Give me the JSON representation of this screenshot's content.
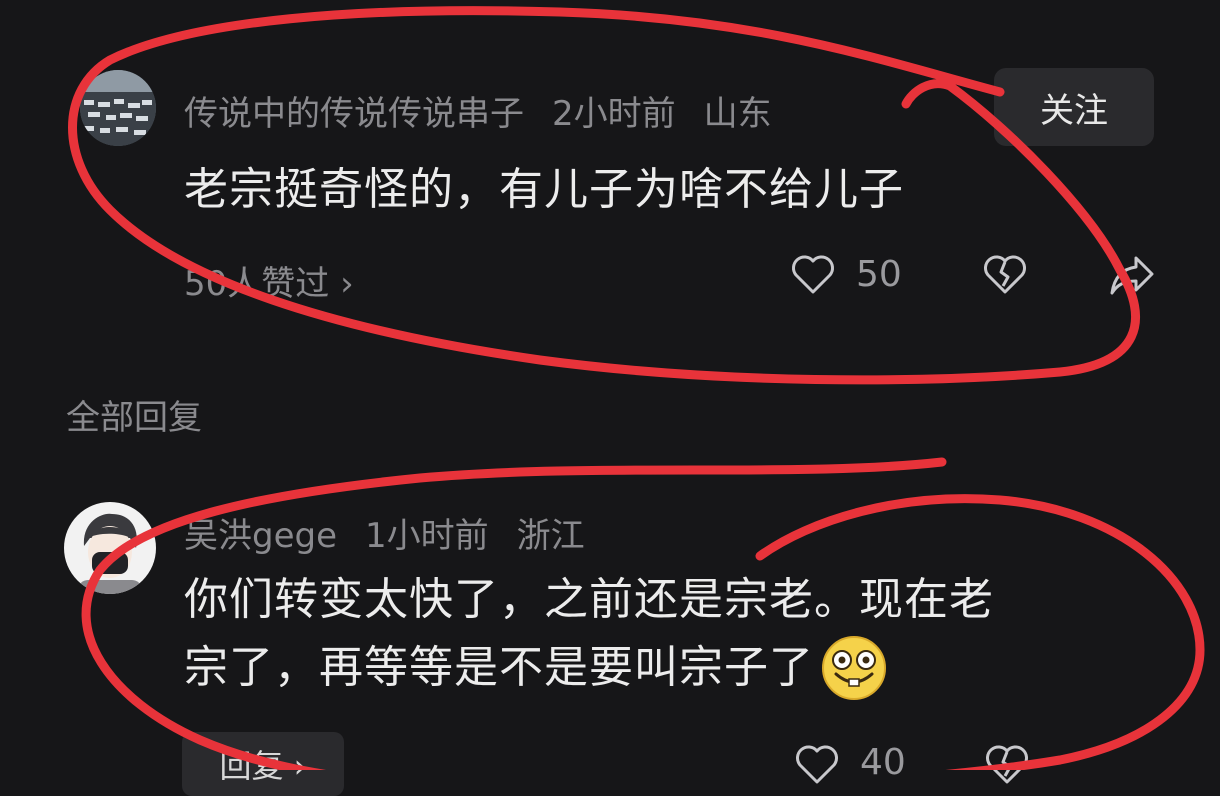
{
  "comment": {
    "author": "传说中的传说传说串子",
    "time": "2小时前",
    "location": "山东",
    "follow_label": "关注",
    "text": "老宗挺奇怪的，有儿子为啥不给儿子",
    "likes_link": "50人赞过 ›",
    "like_count": "50"
  },
  "section_title": "全部回复",
  "reply": {
    "author": "吴洪gege",
    "time": "1小时前",
    "location": "浙江",
    "text_line1": "你们转变太快了，之前还是宗老。现在老",
    "text_line2": "宗了，再等等是不是要叫宗子了",
    "reply_label": "回复 ›",
    "like_count": "40"
  },
  "annotation_color": "#e8333a"
}
